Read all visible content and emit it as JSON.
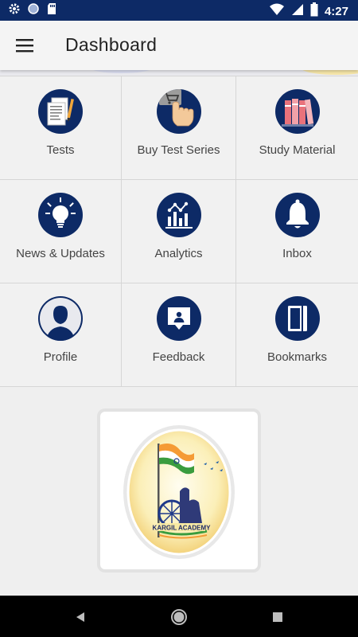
{
  "status_bar": {
    "time": "4:27",
    "icons": [
      "gear-icon",
      "circle-icon",
      "sd-card-icon",
      "wifi-icon",
      "signal-icon",
      "battery-icon"
    ]
  },
  "app_bar": {
    "title": "Dashboard"
  },
  "tiles": [
    {
      "label": "Tests",
      "icon": "test-paper-icon"
    },
    {
      "label": "Buy Test Series",
      "icon": "cart-tap-icon"
    },
    {
      "label": "Study Material",
      "icon": "books-icon"
    },
    {
      "label": "News & Updates",
      "icon": "lightbulb-icon"
    },
    {
      "label": "Analytics",
      "icon": "analytics-icon"
    },
    {
      "label": "Inbox",
      "icon": "bell-icon"
    },
    {
      "label": "Profile",
      "icon": "person-icon"
    },
    {
      "label": "Feedback",
      "icon": "feedback-icon"
    },
    {
      "label": "Bookmarks",
      "icon": "bookmark-icon"
    }
  ],
  "logo": {
    "text": "KARGIL ACADEMY"
  },
  "nav_bar": {
    "buttons": [
      "back-icon",
      "home-icon",
      "recents-icon"
    ]
  },
  "colors": {
    "primary": "#0d2a66",
    "background": "#efefef",
    "tile_label": "#444444"
  }
}
